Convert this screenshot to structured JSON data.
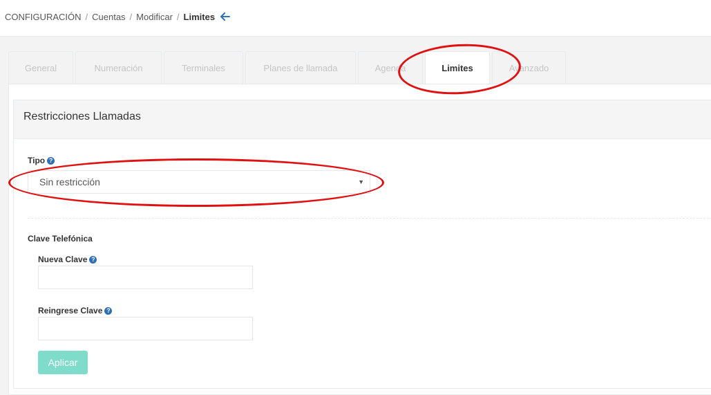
{
  "breadcrumb": {
    "items": [
      "CONFIGURACIÓN",
      "Cuentas",
      "Modificar"
    ],
    "current": "Limites",
    "separator": "/"
  },
  "tabs": [
    {
      "label": "General",
      "active": false
    },
    {
      "label": "Numeración",
      "active": false
    },
    {
      "label": "Terminales",
      "active": false
    },
    {
      "label": "Planes de llamada",
      "active": false
    },
    {
      "label": "Agenda",
      "active": false
    },
    {
      "label": "Limites",
      "active": true
    },
    {
      "label": "Avanzado",
      "active": false
    }
  ],
  "section": {
    "title": "Restricciones Llamadas",
    "tipo_label": "Tipo",
    "tipo_value": "Sin restricción",
    "clave_section_label": "Clave Telefónica",
    "nueva_clave_label": "Nueva Clave",
    "reingrese_clave_label": "Reingrese Clave",
    "apply_label": "Aplicar"
  },
  "icons": {
    "back": "arrow-left-icon",
    "help": "question-circle-icon",
    "caret": "caret-down-icon"
  },
  "colors": {
    "accent": "#2f6fb5",
    "apply_button": "#7fdccb",
    "annotation": "#e01010"
  }
}
